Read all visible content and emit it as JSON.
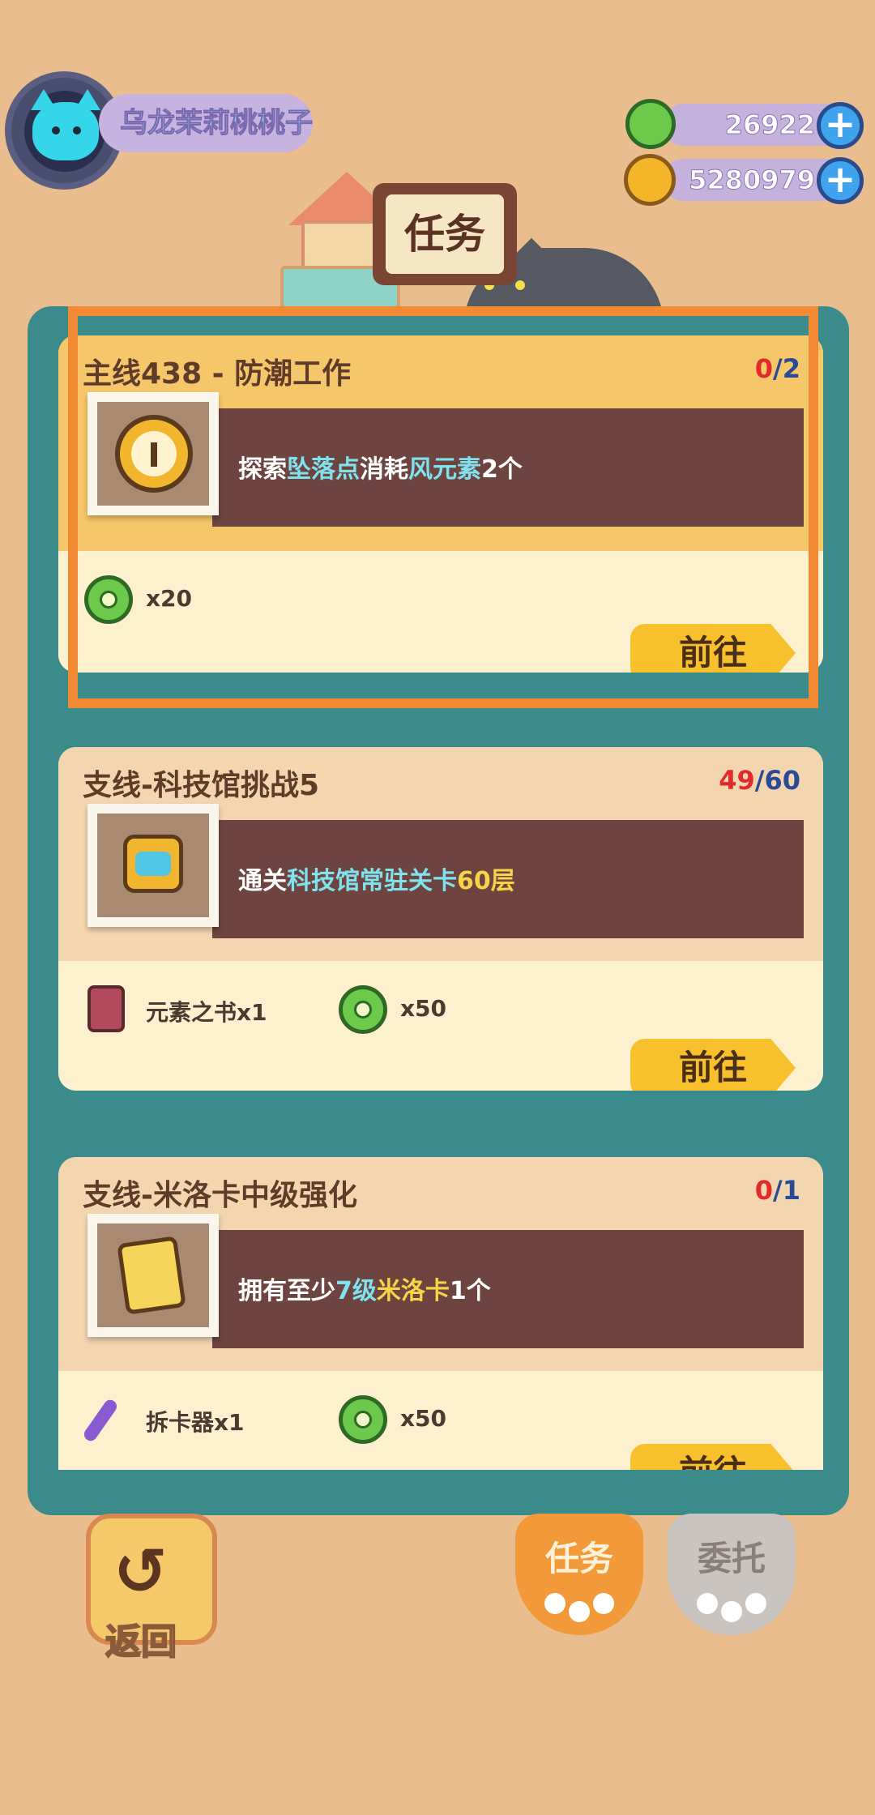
{
  "player": {
    "name": "乌龙茉莉桃桃子",
    "avatar_icon": "cat-face-icon"
  },
  "currencies": [
    {
      "icon": "green-donut-coin-icon",
      "value": "26922"
    },
    {
      "icon": "gold-planet-coin-icon",
      "value": "5280979"
    }
  ],
  "header": {
    "title": "任务"
  },
  "quests": [
    {
      "title": "主线438 - 防潮工作",
      "progress_done": "0",
      "progress_total": "2",
      "icon": "clock-icon",
      "desc": [
        {
          "t": "探索",
          "c": "w"
        },
        {
          "t": "坠落点",
          "c": "b"
        },
        {
          "t": "消耗",
          "c": "w"
        },
        {
          "t": "风元素",
          "c": "b"
        },
        {
          "t": "2个",
          "c": "w"
        }
      ],
      "rewards": [
        {
          "icon": "green-donut-coin-icon",
          "text": "x20"
        }
      ],
      "button": "前往"
    },
    {
      "title": "支线-科技馆挑战5",
      "progress_done": "49",
      "progress_total": "60",
      "icon": "robot-icon",
      "desc": [
        {
          "t": "通关",
          "c": "w"
        },
        {
          "t": "科技馆常驻关卡",
          "c": "b"
        },
        {
          "t": "60层",
          "c": "y"
        }
      ],
      "rewards": [
        {
          "icon": "element-book-icon",
          "text": "元素之书x1"
        },
        {
          "icon": "green-donut-coin-icon",
          "text": "x50"
        }
      ],
      "button": "前往"
    },
    {
      "title": "支线-米洛卡中级强化",
      "progress_done": "0",
      "progress_total": "1",
      "icon": "bunny-card-icon",
      "desc": [
        {
          "t": "拥有至少",
          "c": "w"
        },
        {
          "t": "7级",
          "c": "b"
        },
        {
          "t": "米洛卡",
          "c": "y"
        },
        {
          "t": "1个",
          "c": "w"
        }
      ],
      "rewards": [
        {
          "icon": "card-remover-icon",
          "text": "拆卡器x1"
        },
        {
          "icon": "green-donut-coin-icon",
          "text": "x50"
        }
      ],
      "button": "前往"
    }
  ],
  "bottom": {
    "back_label": "返回",
    "tab_quests": "任务",
    "tab_commission": "委托"
  },
  "colors": {
    "panel": "#3a8b8a",
    "highlight": "#f28a33",
    "button": "#f8c02c"
  }
}
